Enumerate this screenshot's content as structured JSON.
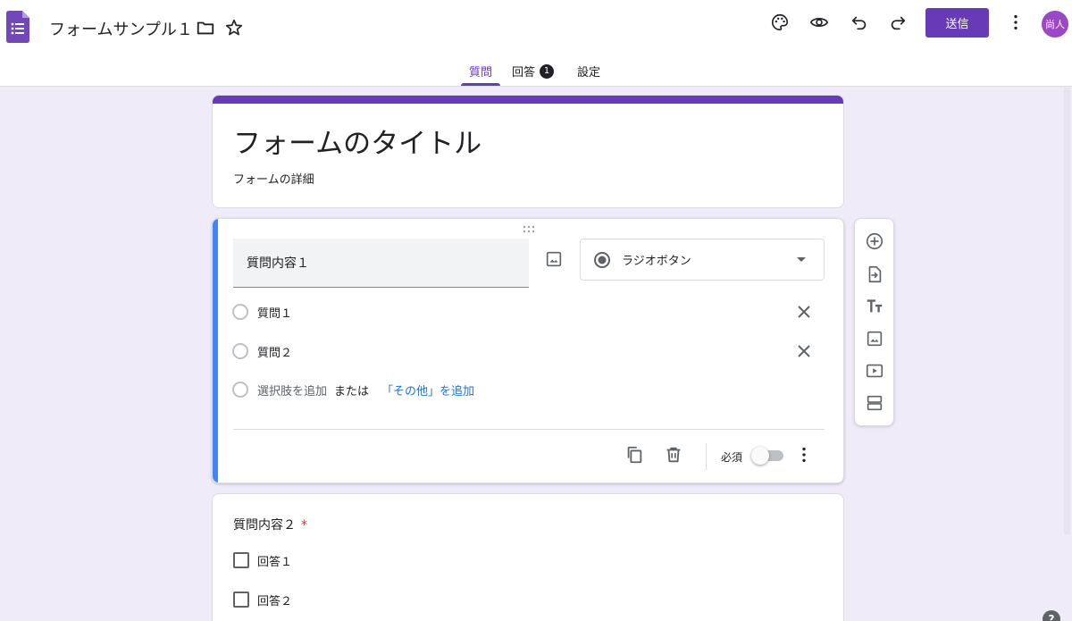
{
  "header": {
    "doc_title": "フォームサンプル１",
    "send_label": "送信",
    "avatar_text": "尚人",
    "brand_color": "#673ab7",
    "icons": [
      "forms-logo-icon",
      "folder-icon",
      "star-icon",
      "palette-icon",
      "preview-eye-icon",
      "undo-icon",
      "redo-icon",
      "more-vert-icon"
    ]
  },
  "tabs": [
    {
      "label": "質問",
      "active": true
    },
    {
      "label": "回答",
      "badge": "1"
    },
    {
      "label": "設定"
    }
  ],
  "form": {
    "title": "フォームのタイトル",
    "description": "フォームの詳細"
  },
  "question1": {
    "title": "質問内容１",
    "type_label": "ラジオボタン",
    "options": [
      "質問１",
      "質問２"
    ],
    "add_option": "選択肢を追加",
    "or_text": "または",
    "add_other": "「その他」を追加",
    "required_label": "必須",
    "required": false
  },
  "question2": {
    "title": "質問内容２",
    "required_mark": "*",
    "options": [
      "回答１",
      "回答２"
    ]
  },
  "side_toolbar": [
    "add-question-icon",
    "import-questions-icon",
    "add-title-icon",
    "add-image-icon",
    "add-video-icon",
    "add-section-icon"
  ],
  "help_label": "?"
}
